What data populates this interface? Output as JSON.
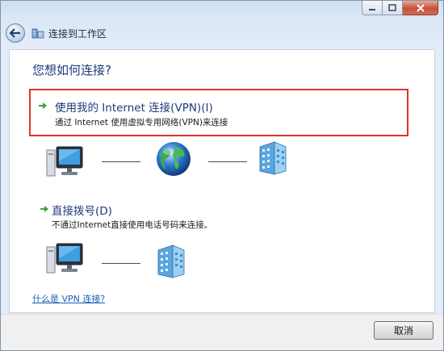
{
  "window": {
    "nav_title": "连接到工作区"
  },
  "content": {
    "question": "您想如何连接?",
    "options": [
      {
        "title": "使用我的 Internet 连接(VPN)(I)",
        "description": "通过 Internet 使用虚拟专用网络(VPN)来连接",
        "highlighted": true,
        "highlight_color": "#e0312b"
      },
      {
        "title": "直接拨号(D)",
        "description": "不通过Internet直接使用电话号码来连接。",
        "highlighted": false
      }
    ],
    "vpn_diagram": [
      "computer-icon",
      "globe-icon",
      "server-building-icon"
    ],
    "dial_diagram": [
      "computer-icon",
      "server-building-icon"
    ],
    "help_link": "什么是 VPN 连接?"
  },
  "footer": {
    "cancel_label": "取消"
  },
  "colors": {
    "heading": "#1e3a78",
    "link": "#1d5fb5",
    "arrow": "#3aa33a"
  }
}
